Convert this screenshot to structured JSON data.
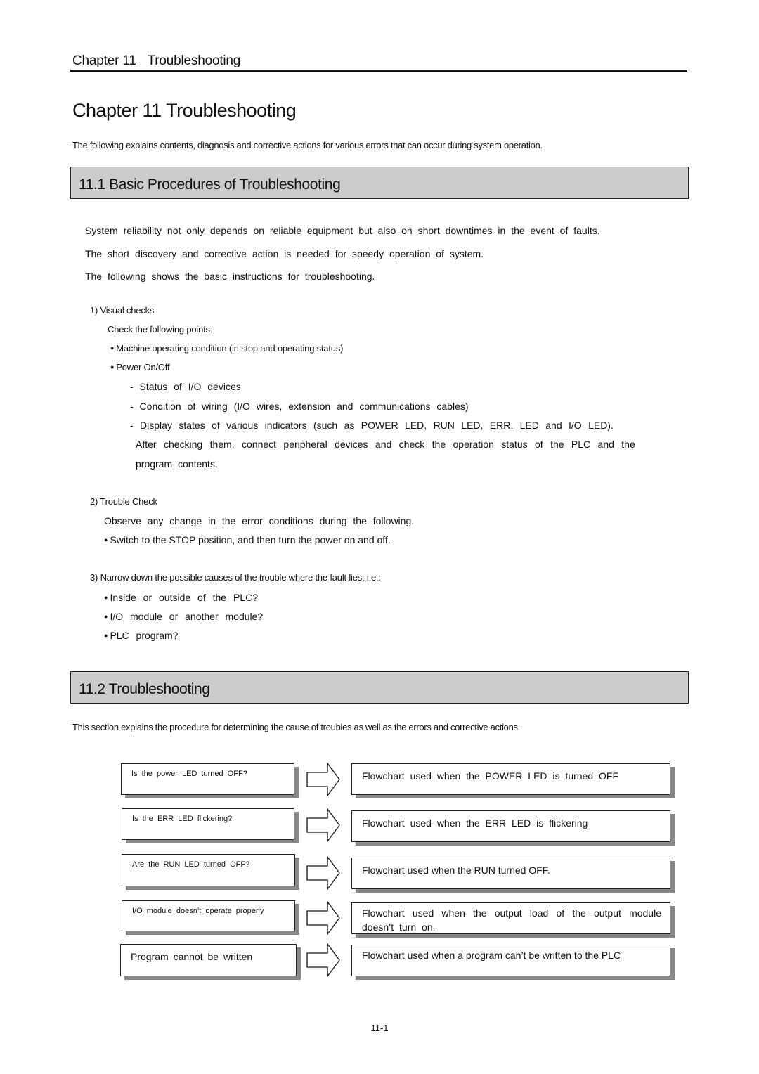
{
  "header": {
    "running_chapter": "Chapter 11",
    "running_title": "Troubleshooting"
  },
  "chapter_title": "Chapter 11 Troubleshooting",
  "intro": "The following explains contents, diagnosis and corrective actions for various errors that can occur during system operation.",
  "section1": {
    "title": "11.1 Basic Procedures of Troubleshooting",
    "paragraphs": [
      "System reliability not only depends on reliable equipment but also on short downtimes in the event of faults.",
      "The short discovery and corrective action is needed for speedy operation of system.",
      "The following shows the basic instructions for troubleshooting."
    ],
    "visual_checks": {
      "heading": "1) Visual checks",
      "lead": "Check the following points.",
      "bullets": [
        "Machine operating condition (in stop and operating status)",
        "Power On/Off"
      ],
      "dashes": [
        "- Status of I/O devices",
        "- Condition of wiring (I/O wires, extension and communications cables)",
        "- Display states of various indicators (such as POWER LED, RUN LED, ERR. LED and I/O LED)."
      ],
      "followup_line1": "After checking them, connect peripheral devices and check the operation status of the PLC and the",
      "followup_line2": "program contents."
    },
    "trouble_check": {
      "heading": "2) Trouble Check",
      "lead": "Observe any change in the error conditions during the following.",
      "bullets": [
        "Switch to the STOP position, and then turn the power on and off."
      ]
    },
    "narrow_down": {
      "heading": "3) Narrow down the possible causes of the trouble where the fault lies, i.e.:",
      "bullets": [
        "Inside or outside of the PLC?",
        "I/O module or another module?",
        "PLC program?"
      ]
    }
  },
  "section2": {
    "title": "11.2 Troubleshooting",
    "intro": "This section explains the procedure for determining the cause of troubles as well as the errors and corrective actions.",
    "flow": [
      {
        "symptom": "Is the power LED turned OFF?",
        "action": "Flowchart used when the POWER LED is turned OFF"
      },
      {
        "symptom": "Is the ERR LED flickering?",
        "action": "Flowchart used when the ERR LED is flickering"
      },
      {
        "symptom": "Are the RUN LED turned OFF?",
        "action": "Flowchart used when the RUN turned OFF."
      },
      {
        "symptom": "I/O module doesn’t operate properly",
        "action": "Flowchart used when the output load of the output module doesn’t turn on."
      },
      {
        "symptom": "Program cannot be written",
        "action": "Flowchart used when a program can’t be written to the PLC"
      }
    ]
  },
  "page_number": "11-1"
}
